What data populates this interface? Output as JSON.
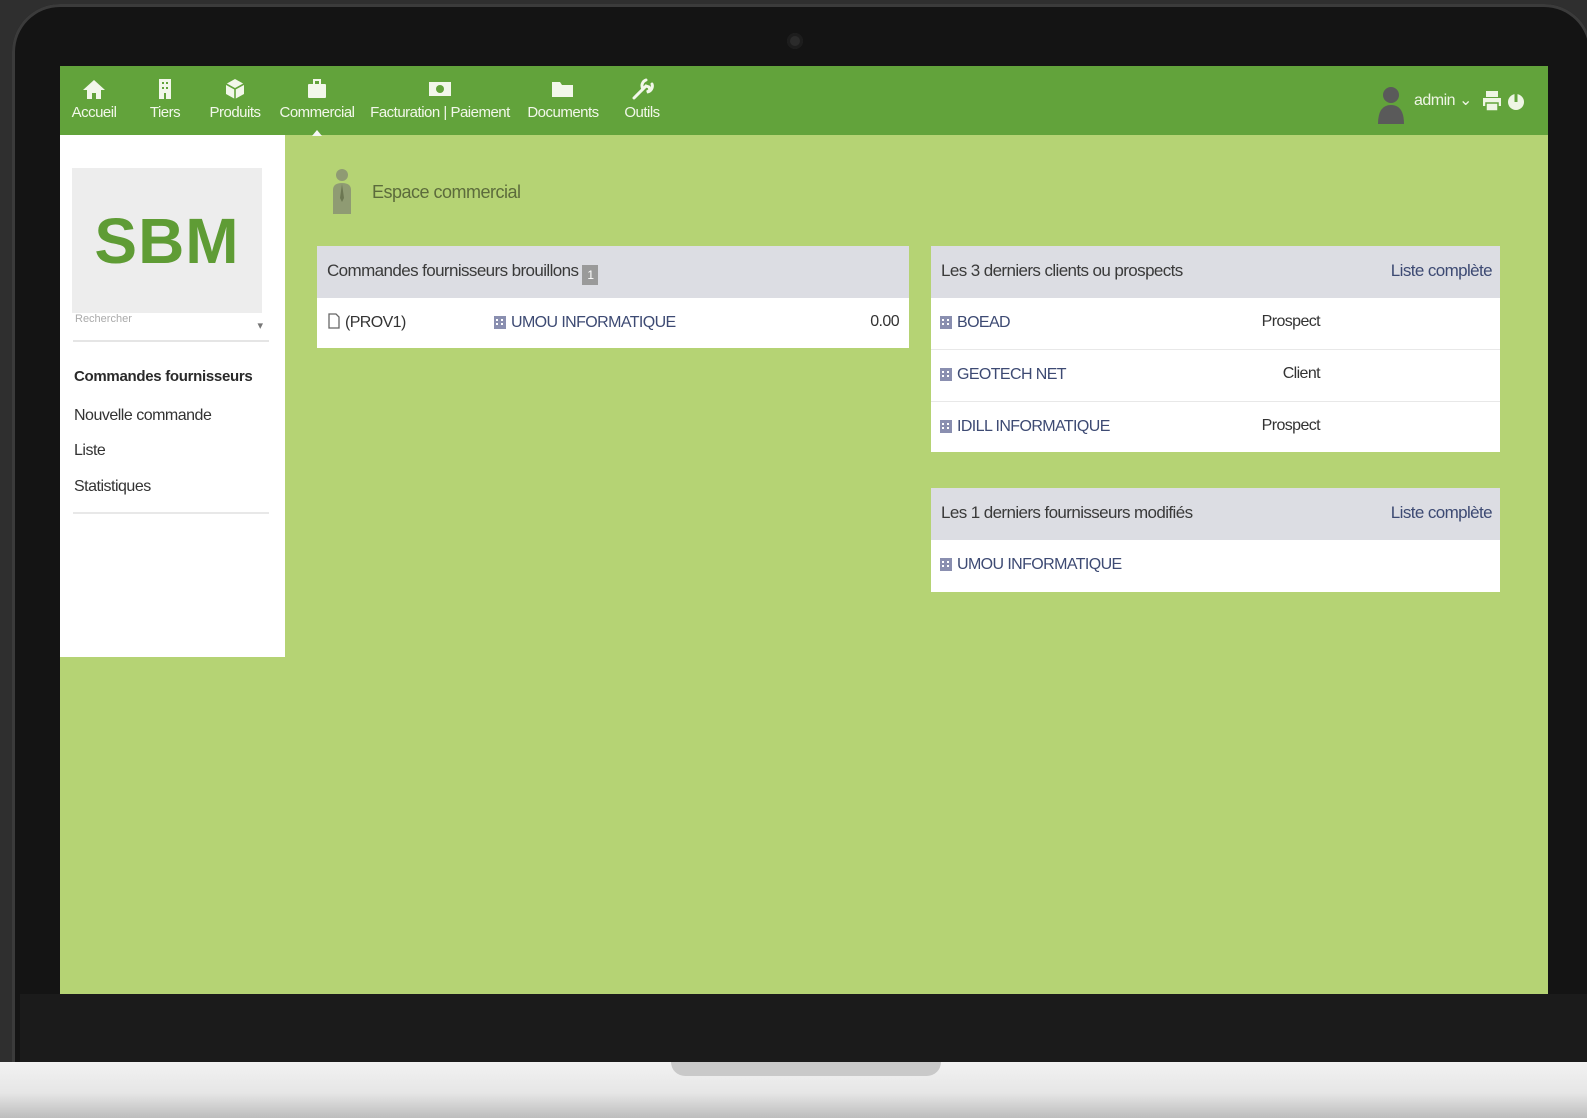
{
  "nav": {
    "items": [
      {
        "label": "Accueil",
        "icon": "home-icon"
      },
      {
        "label": "Tiers",
        "icon": "building-icon"
      },
      {
        "label": "Produits",
        "icon": "cube-icon"
      },
      {
        "label": "Commercial",
        "icon": "briefcase-icon",
        "active": true
      },
      {
        "label": "Facturation | Paiement",
        "icon": "money-icon"
      },
      {
        "label": "Documents",
        "icon": "folder-icon"
      },
      {
        "label": "Outils",
        "icon": "wrench-icon"
      }
    ],
    "user": "admin",
    "user_caret": "⌄"
  },
  "sidebar": {
    "logo_text": "SBM",
    "search_placeholder": "Rechercher",
    "menu_title": "Commandes fournisseurs",
    "links": [
      "Nouvelle commande",
      "Liste",
      "Statistiques"
    ]
  },
  "page": {
    "title": "Espace commercial"
  },
  "drafts_box": {
    "title": "Commandes fournisseurs brouillons",
    "count": "1",
    "rows": [
      {
        "ref": "(PROV1)",
        "supplier": "UMOU INFORMATIQUE",
        "amount": "0.00"
      }
    ]
  },
  "clients_box": {
    "title": "Les 3 derniers clients ou prospects",
    "link": "Liste complète",
    "rows": [
      {
        "name": "BOEAD",
        "status": "Prospect"
      },
      {
        "name": "GEOTECH NET",
        "status": "Client"
      },
      {
        "name": "IDILL INFORMATIQUE",
        "status": "Prospect"
      }
    ]
  },
  "suppliers_box": {
    "title": "Les 1 derniers fournisseurs modifiés",
    "link": "Liste complète",
    "rows": [
      {
        "name": "UMOU INFORMATIQUE"
      }
    ]
  },
  "colors": {
    "topbar": "#62a33b",
    "background": "#b5d374",
    "logo": "#5f9c35"
  }
}
